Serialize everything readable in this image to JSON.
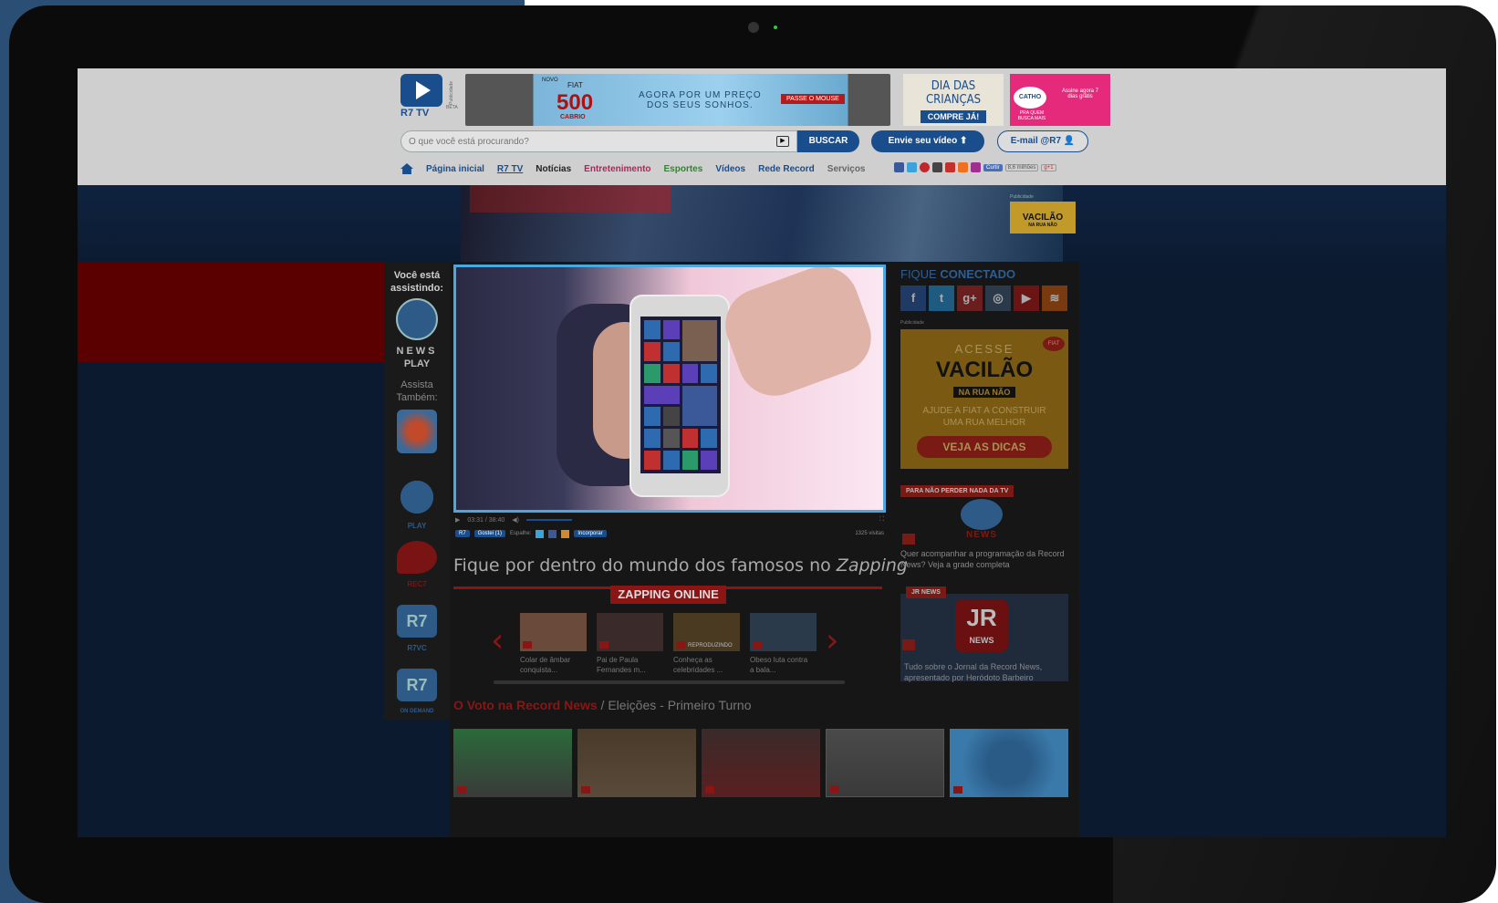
{
  "logo": {
    "text": "R7 TV",
    "beta": "BETA"
  },
  "ad_label": "Publicidade",
  "ads": {
    "fiat": {
      "small": "NOVO",
      "brand": "FIAT",
      "model": "500",
      "model_sub": "CABRIO",
      "line1": "AGORA POR UM PREÇO",
      "line2": "DOS SEUS SONHOS.",
      "cta": "PASSE O MOUSE"
    },
    "dia": {
      "title1": "DIA",
      "title2": "DAS CRIANÇAS",
      "cta": "COMPRE JÁ!"
    },
    "catho": {
      "brand": "CATHO",
      "tag": "PRA QUEM BUSCA MAIS",
      "offer": "Assine agora 7 dias grátis"
    }
  },
  "search": {
    "placeholder": "O que você está procurando?",
    "button": "BUSCAR"
  },
  "send_video": "Envie seu vídeo",
  "email": "E-mail @R7",
  "nav": [
    {
      "label": "Página inicial",
      "color": "#1a4d8c"
    },
    {
      "label": "R7 TV",
      "color": "#1a4d8c"
    },
    {
      "label": "Notícias",
      "color": "#222222"
    },
    {
      "label": "Entretenimento",
      "color": "#b0245a"
    },
    {
      "label": "Esportes",
      "color": "#2a8a2a"
    },
    {
      "label": "Vídeos",
      "color": "#1a4d8c"
    },
    {
      "label": "Rede Record",
      "color": "#1a4d8c"
    },
    {
      "label": "Serviços",
      "color": "#666666"
    }
  ],
  "social_bar": {
    "curtir": "Curtir",
    "count": "8,6 milhões",
    "gplus": "g+1"
  },
  "banner_ad": {
    "label": "Publicidade",
    "text": "VACILÃO",
    "sub": "NA RUA NÃO"
  },
  "sidebar": {
    "watching": "Você está assistindo:",
    "channel": "NEWS",
    "channel_sub": "PLAY",
    "also": "Assista Também:",
    "channels": [
      "",
      "PLAY",
      "REC7",
      "R7VC",
      "ON DEMAND"
    ]
  },
  "player": {
    "time": "03:31 / 38:40",
    "r7": "R7",
    "like": "Gostei (1)",
    "share": "Espalhe:",
    "embed": "Incorporar",
    "views": "1325 visitas"
  },
  "headline": {
    "text": "Fique por dentro do mundo dos famosos no ",
    "emph": "Zapping"
  },
  "zapping": {
    "title": "ZAPPING ONLINE",
    "items": [
      {
        "line1": "Colar de âmbar",
        "line2": "conquista..."
      },
      {
        "line1": "Pai de Paula",
        "line2": "Fernandes m..."
      },
      {
        "line1": "Conheça as",
        "line2": "celebridades ...",
        "badge": "REPRODUZINDO"
      },
      {
        "line1": "Obeso luta contra",
        "line2": "a bala..."
      }
    ]
  },
  "voto": {
    "title": "O Voto na Record News",
    "sub": " / Eleições - Primeiro Turno"
  },
  "right": {
    "fique": "FIQUE",
    "conectado": "CONECTADO",
    "pub": "Publicidade",
    "vacila": {
      "acesse": "ACESSE",
      "v": "VACILÃO",
      "n": "NA RUA NÃO",
      "d1": "AJUDE A FIAT A CONSTRUIR",
      "d2": "UMA RUA MELHOR",
      "btn": "VEJA AS DICAS",
      "brand": "FIAT"
    },
    "card1": {
      "tag": "PARA NÃO PERDER NADA DA TV",
      "logo": "NEWS",
      "text": "Quer acompanhar a programação da Record News? Veja a grade completa"
    },
    "card2": {
      "tag": "JR NEWS",
      "logo": "JR",
      "sub": "NEWS",
      "text": "Tudo sobre o Jornal da Record News, apresentado por Heródoto Barbeiro"
    }
  }
}
